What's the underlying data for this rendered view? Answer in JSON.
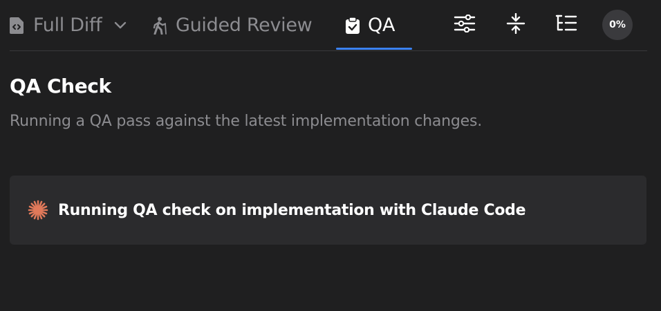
{
  "tabs": {
    "full_diff": {
      "label": "Full Diff",
      "icon": "file-code-icon"
    },
    "guided_review": {
      "label": "Guided Review",
      "icon": "hiking-icon"
    },
    "qa": {
      "label": "QA",
      "icon": "clipboard-check-icon",
      "active": true
    }
  },
  "toolbar": {
    "filters_icon": "sliders-icon",
    "collapse_icon": "collapse-vertical-icon",
    "tree_icon": "list-tree-icon",
    "progress": "0%"
  },
  "main": {
    "title": "QA Check",
    "subtitle": "Running a QA pass against the latest implementation changes.",
    "status": {
      "icon": "claude-spark-icon",
      "text": "Running QA check on implementation with Claude Code"
    }
  },
  "colors": {
    "background": "#1f1f20",
    "card": "#2b2b2d",
    "accent": "#3b82f6",
    "spark": "#e0795a",
    "muted_text": "#8c8c90"
  }
}
